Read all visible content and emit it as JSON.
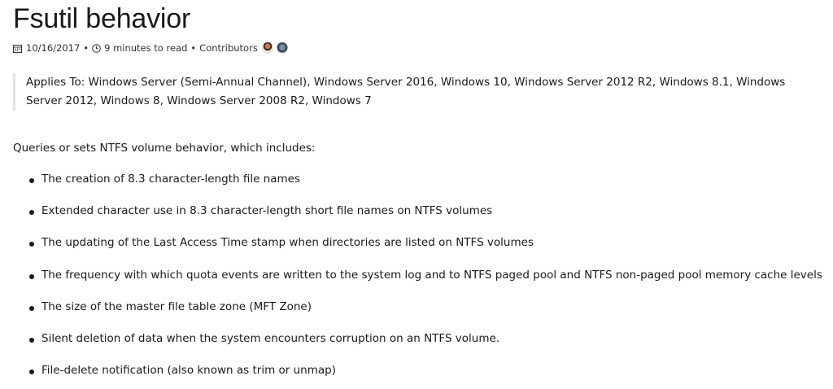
{
  "page": {
    "title": "Fsutil behavior",
    "meta": {
      "date": "10/16/2017",
      "separator": "•",
      "read_time": "9 minutes to read",
      "contributors_label": "Contributors",
      "icons": [
        "calendar-icon",
        "clock-icon"
      ]
    },
    "applies_to": "Applies To: Windows Server (Semi-Annual Channel), Windows Server 2016, Windows 10, Windows Server 2012 R2, Windows 8.1, Windows Server 2012, Windows 8, Windows Server 2008 R2, Windows 7",
    "intro": "Queries or sets NTFS volume behavior, which includes:",
    "bullets": [
      "The creation of 8.3 character-length file names",
      "Extended character use in 8.3 character-length short file names on NTFS volumes",
      "The updating of the Last Access Time stamp when directories are listed on NTFS volumes",
      "The frequency with which quota events are written to the system log and to NTFS paged pool and NTFS non-paged pool memory cache levels",
      "The size of the master file table zone (MFT Zone)",
      "Silent deletion of data when the system encounters corruption on an NTFS volume.",
      "File-delete notification (also known as trim or unmap)"
    ]
  }
}
